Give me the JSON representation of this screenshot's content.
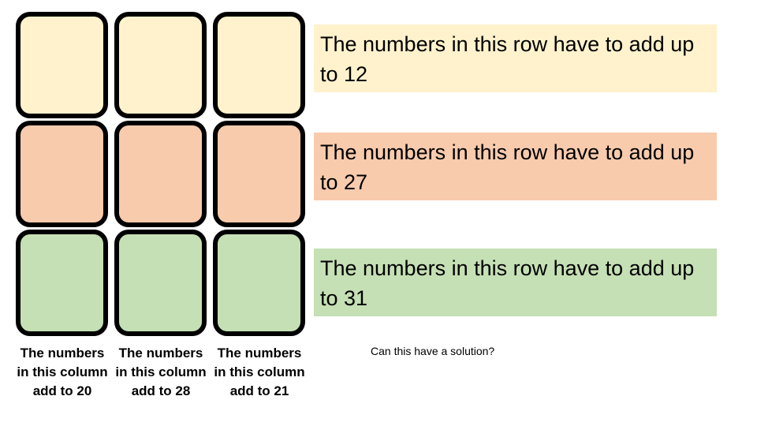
{
  "colors": {
    "row_1": "#FFF2CC",
    "row_2": "#F8CBAD",
    "row_3": "#C5E0B4",
    "tile_border": "#000000"
  },
  "grid": {
    "rows": 3,
    "columns": 3,
    "tiles": [
      [
        "",
        "",
        ""
      ],
      [
        "",
        "",
        ""
      ],
      [
        "",
        "",
        ""
      ]
    ]
  },
  "row_clues": [
    {
      "text": "The numbers in this row have to add up to 12",
      "sum": 12
    },
    {
      "text": "The numbers in this row have to add up to 27",
      "sum": 27
    },
    {
      "text": "The numbers in this row have to add up to 31",
      "sum": 31
    }
  ],
  "column_clues": [
    {
      "text": "The numbers in this column add to 20",
      "sum": 20
    },
    {
      "text": "The numbers in this column add to 28",
      "sum": 28
    },
    {
      "text": "The numbers in this column add to 21",
      "sum": 21
    }
  ],
  "question": "Can this have a solution?"
}
